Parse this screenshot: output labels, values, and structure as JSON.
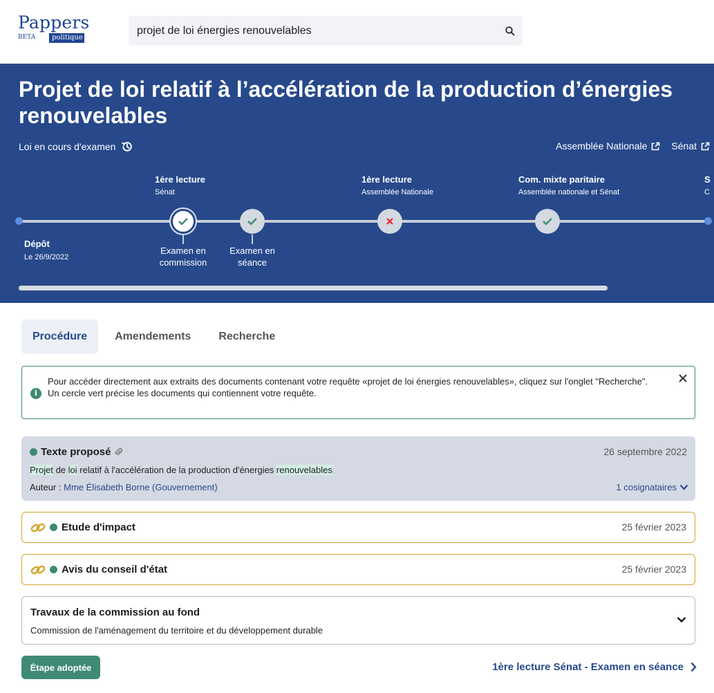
{
  "logo": {
    "name": "Pappers",
    "beta": "BETA",
    "tag": "politique"
  },
  "search": {
    "value": "projet de loi énergies renouvelables",
    "icon": "search-icon"
  },
  "banner": {
    "title": "Projet de loi relatif à l’accélération de la production d’énergies renouvelables",
    "status": "Loi en cours d'examen",
    "links": [
      "Assemblée Nationale",
      "Sénat"
    ]
  },
  "timeline": {
    "depot": {
      "label": "Dépôt",
      "date": "Le 26/9/2022"
    },
    "stages": [
      {
        "label": "1ère lecture",
        "sub": "Sénat"
      },
      {
        "label": "1ère lecture",
        "sub": "Assemblée Nationale"
      },
      {
        "label": "Com. mixte paritaire",
        "sub": "Assemblée nationale et Sénat"
      },
      {
        "label": "S",
        "sub": "C"
      }
    ],
    "steps": [
      {
        "caption1": "Examen en",
        "caption2": "commission",
        "state": "done"
      },
      {
        "caption1": "Examen en",
        "caption2": "séance",
        "state": "done"
      },
      {
        "state": "rejected"
      },
      {
        "state": "done"
      }
    ]
  },
  "tabs": [
    "Procédure",
    "Amendements",
    "Recherche"
  ],
  "info": {
    "line1": "Pour accéder directement aux extraits des documents contenant votre requête «projet de loi énergies renouvelables», cliquez sur l'onglet \"Recherche\".",
    "line2": "Un cercle vert précise les documents qui contiennent votre requête."
  },
  "texte": {
    "title": "Texte proposé",
    "date": "26 septembre 2022",
    "desc": {
      "w1": "Projet",
      "w2": " de ",
      "w3": "loi",
      "w4": " relatif à l'accélération de la production d'énergies ",
      "w5": "renouvelables"
    },
    "author_label": "Auteur : ",
    "author": "Mme Élisabeth Borne (Gouvernement)",
    "cosign": "1 cosignataires"
  },
  "docs": [
    {
      "title": "Etude d'impact",
      "date": "25 février 2023"
    },
    {
      "title": "Avis du conseil d'état",
      "date": "25 février 2023"
    }
  ],
  "travaux": {
    "title": "Travaux de la commission au fond",
    "sub": "Commission de l'aménagement du territoire et du développement durable"
  },
  "footer": {
    "badge": "Étape adoptée",
    "next": "1ère lecture Sénat - Examen en séance"
  }
}
